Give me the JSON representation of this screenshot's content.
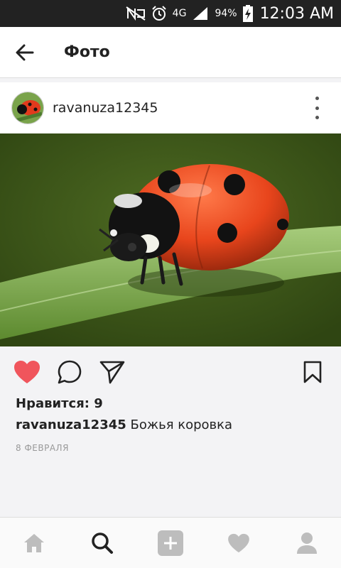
{
  "status_bar": {
    "network": "4G",
    "battery": "94%",
    "time": "12:03 AM"
  },
  "header": {
    "title": "Фото"
  },
  "post": {
    "username": "ravanuza12345",
    "likes_label": "Нравится: 9",
    "caption_user": "ravanuza12345",
    "caption_text": " Божья коровка",
    "date": "8 ФЕВРАЛЯ",
    "liked": true
  },
  "colors": {
    "like_red": "#f0555c",
    "icon_dark": "#222222",
    "icon_grey": "#bdbdbd"
  },
  "icons": {
    "back": "arrow-left-icon",
    "more": "more-vertical-icon",
    "like": "heart-icon",
    "comment": "comment-icon",
    "share": "send-icon",
    "save": "bookmark-icon",
    "nav": [
      "home-icon",
      "search-icon",
      "add-icon",
      "activity-heart-icon",
      "profile-icon"
    ]
  }
}
